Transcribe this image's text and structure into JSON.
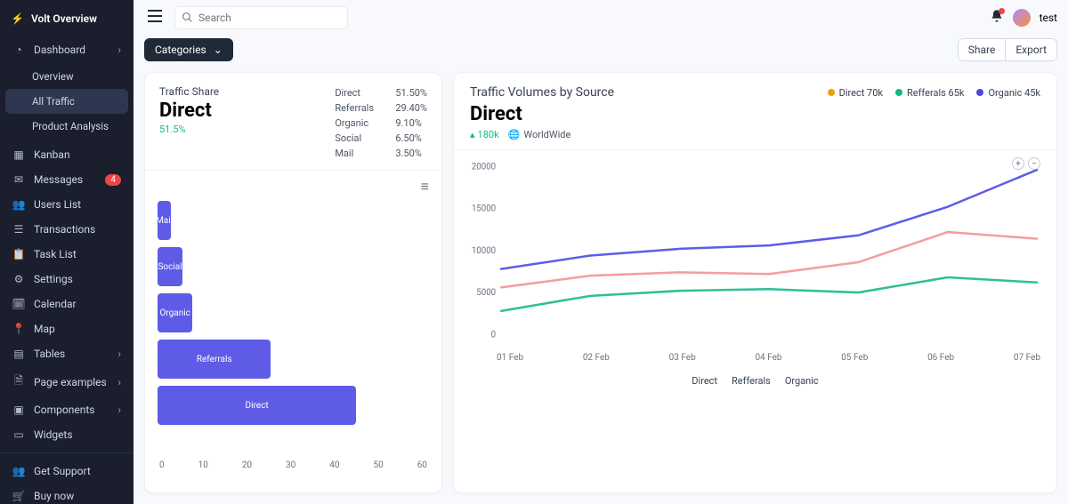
{
  "brand": "Volt Overview",
  "sidebar": {
    "items": [
      {
        "label": "Dashboard",
        "icon": "pie"
      },
      {
        "label": "Kanban",
        "icon": "grid"
      },
      {
        "label": "Messages",
        "icon": "chat",
        "badge": "4"
      },
      {
        "label": "Users List",
        "icon": "users"
      },
      {
        "label": "Transactions",
        "icon": "card"
      },
      {
        "label": "Task List",
        "icon": "clip"
      },
      {
        "label": "Settings",
        "icon": "gear"
      },
      {
        "label": "Calendar",
        "icon": "cal"
      },
      {
        "label": "Map",
        "icon": "pin"
      },
      {
        "label": "Tables",
        "icon": "table"
      },
      {
        "label": "Page examples",
        "icon": "page"
      },
      {
        "label": "Components",
        "icon": "comp"
      },
      {
        "label": "Widgets",
        "icon": "widg"
      }
    ],
    "dash_sub": [
      {
        "label": "Overview"
      },
      {
        "label": "All Traffic"
      },
      {
        "label": "Product Analysis"
      }
    ],
    "footer": [
      {
        "label": "Get Support",
        "icon": "support"
      },
      {
        "label": "Buy now",
        "icon": "cart"
      }
    ]
  },
  "search_placeholder": "Search",
  "user": "test",
  "toolbar": {
    "categories": "Categories",
    "share": "Share",
    "export": "Export"
  },
  "traffic_share": {
    "title_small": "Traffic Share",
    "title_big": "Direct",
    "pct": "51.5%",
    "rows": [
      {
        "label": "Direct",
        "val": "51.50%"
      },
      {
        "label": "Referrals",
        "val": "29.40%"
      },
      {
        "label": "Organic",
        "val": "9.10%"
      },
      {
        "label": "Social",
        "val": "6.50%"
      },
      {
        "label": "Mail",
        "val": "3.50%"
      }
    ]
  },
  "traffic_vol": {
    "title": "Traffic Volumes by Source",
    "legend": [
      {
        "label": "Direct 70k",
        "color": "#f59e0b"
      },
      {
        "label": "Refferals 65k",
        "color": "#10b981"
      },
      {
        "label": "Organic 45k",
        "color": "#4f46e5"
      }
    ],
    "heading": "Direct",
    "delta": "180k",
    "scope": "WorldWide",
    "legend2": [
      {
        "label": "Direct",
        "color": "#5e5ce6"
      },
      {
        "label": "Refferals",
        "color": "#f49da0"
      },
      {
        "label": "Organic",
        "color": "#2fbf9a"
      }
    ]
  },
  "chart_data": [
    {
      "type": "bar",
      "orientation": "horizontal",
      "title": "Traffic Share",
      "categories": [
        "Mail",
        "Social",
        "Organic",
        "Referrals",
        "Direct"
      ],
      "values": [
        3.5,
        6.5,
        9.1,
        29.4,
        51.5
      ],
      "xlabel": "",
      "ylabel": "",
      "xlim": [
        0,
        60
      ],
      "xticks": [
        0,
        10,
        20,
        30,
        40,
        50,
        60
      ],
      "bar_color": "#5e5ce6"
    },
    {
      "type": "line",
      "title": "Traffic Volumes by Source",
      "x": [
        "01 Feb",
        "02 Feb",
        "03 Feb",
        "04 Feb",
        "05 Feb",
        "06 Feb",
        "07 Feb"
      ],
      "series": [
        {
          "name": "Direct",
          "color": "#5e5ce6",
          "values": [
            7800,
            9400,
            10200,
            10600,
            11800,
            15200,
            19600
          ]
        },
        {
          "name": "Refferals",
          "color": "#f49da0",
          "values": [
            5600,
            7000,
            7400,
            7200,
            8600,
            12200,
            11400
          ]
        },
        {
          "name": "Organic",
          "color": "#2fbf9a",
          "values": [
            2800,
            4600,
            5200,
            5400,
            5000,
            6800,
            6200
          ]
        }
      ],
      "ylim": [
        0,
        20000
      ],
      "yticks": [
        0,
        5000,
        10000,
        15000,
        20000
      ]
    }
  ]
}
